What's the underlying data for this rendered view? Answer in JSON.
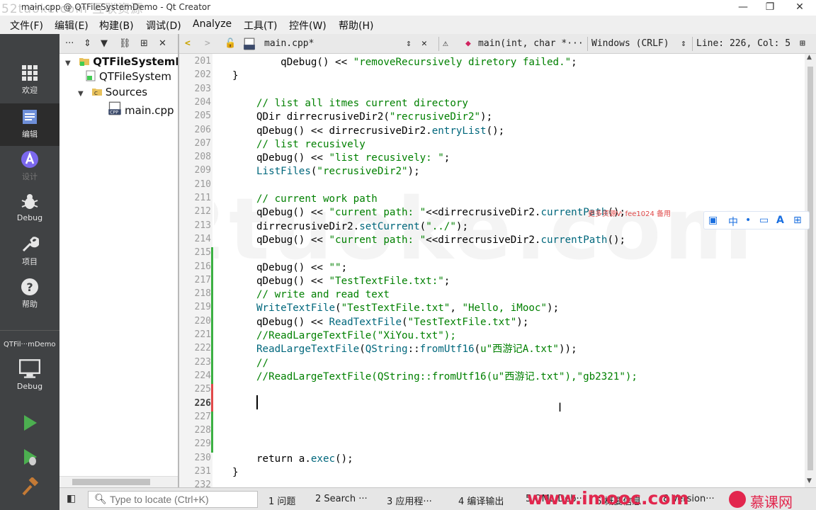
{
  "window": {
    "title": "main.cpp @ QTFileSystemDemo - Qt Creator",
    "watermark_top": "52tuoke.com  互联资源"
  },
  "menu": [
    "文件(F)",
    "编辑(E)",
    "构建(B)",
    "调试(D)",
    "Analyze",
    "工具(T)",
    "控件(W)",
    "帮助(H)"
  ],
  "modes": {
    "welcome": "欢迎",
    "edit": "编辑",
    "design": "设计",
    "debug": "Debug",
    "projects": "项目",
    "help": "帮助",
    "kit_name": "QTFil···mDemo",
    "kit_mode": "Debug"
  },
  "tree": {
    "project": "QTFileSystemDe",
    "pro_file": "QTFileSystem",
    "sources": "Sources",
    "file": "main.cpp"
  },
  "editor_toolbar": {
    "file": "main.cpp*",
    "function": "main(int, char *···",
    "line_ending": "Windows (CRLF)",
    "position": "Line: 226, Col: 5"
  },
  "editor": {
    "first_line": 201,
    "current_line": 226,
    "lines": [
      [
        [
          "    qDebug() << ",
          "t"
        ],
        [
          "\"removeRecursively diretory failed.\"",
          "s"
        ],
        [
          ";",
          "t"
        ]
      ],
      [
        [
          "}",
          "t"
        ]
      ],
      [
        [
          "",
          "t"
        ]
      ],
      [
        [
          "// list all itmes current directory",
          "c"
        ]
      ],
      [
        [
          "QDir dirrecrusiveDir2(",
          "t"
        ],
        [
          "\"recrusiveDir2\"",
          "s"
        ],
        [
          ");",
          "t"
        ]
      ],
      [
        [
          "qDebug() << dirrecrusiveDir2.",
          "t"
        ],
        [
          "entryList",
          "f"
        ],
        [
          "();",
          "t"
        ]
      ],
      [
        [
          "// list recusively",
          "c"
        ]
      ],
      [
        [
          "qDebug() << ",
          "t"
        ],
        [
          "\"list recusively: \"",
          "s"
        ],
        [
          ";",
          "t"
        ]
      ],
      [
        [
          "ListFiles",
          "f"
        ],
        [
          "(",
          "t"
        ],
        [
          "\"recrusiveDir2\"",
          "s"
        ],
        [
          ");",
          "t"
        ]
      ],
      [
        [
          "",
          "t"
        ]
      ],
      [
        [
          "// current work path",
          "c"
        ]
      ],
      [
        [
          "qDebug() << ",
          "t"
        ],
        [
          "\"current path: \"",
          "s"
        ],
        [
          "<<dirrecrusiveDir2.",
          "t"
        ],
        [
          "currentPath",
          "f"
        ],
        [
          "();",
          "t"
        ]
      ],
      [
        [
          "dirrecrusiveDir2.",
          "t"
        ],
        [
          "setCurrent",
          "f"
        ],
        [
          "(",
          "t"
        ],
        [
          "\"../\"",
          "s"
        ],
        [
          ");",
          "t"
        ]
      ],
      [
        [
          "qDebug() << ",
          "t"
        ],
        [
          "\"current path: \"",
          "s"
        ],
        [
          "<<dirrecrusiveDir2.",
          "t"
        ],
        [
          "currentPath",
          "f"
        ],
        [
          "();",
          "t"
        ]
      ],
      [
        [
          "",
          "t"
        ]
      ],
      [
        [
          "qDebug() << ",
          "t"
        ],
        [
          "\"\"",
          "s"
        ],
        [
          ";",
          "t"
        ]
      ],
      [
        [
          "qDebug() << ",
          "t"
        ],
        [
          "\"TestTextFile.txt:\"",
          "s"
        ],
        [
          ";",
          "t"
        ]
      ],
      [
        [
          "// write and read text",
          "c"
        ]
      ],
      [
        [
          "WriteTextFile",
          "f"
        ],
        [
          "(",
          "t"
        ],
        [
          "\"TestTextFile.txt\"",
          "s"
        ],
        [
          ", ",
          "t"
        ],
        [
          "\"Hello, iMooc\"",
          "s"
        ],
        [
          ");",
          "t"
        ]
      ],
      [
        [
          "qDebug() << ",
          "t"
        ],
        [
          "ReadTextFile",
          "f"
        ],
        [
          "(",
          "t"
        ],
        [
          "\"TestTextFile.txt\"",
          "s"
        ],
        [
          ");",
          "t"
        ]
      ],
      [
        [
          "//ReadLargeTextFile(\"XiYou.txt\");",
          "c"
        ]
      ],
      [
        [
          "ReadLargeTextFile",
          "f"
        ],
        [
          "(",
          "t"
        ],
        [
          "QString",
          "f"
        ],
        [
          "::",
          "t"
        ],
        [
          "fromUtf16",
          "f"
        ],
        [
          "(",
          "t"
        ],
        [
          "u\"西游记A.txt\"",
          "s"
        ],
        [
          "));",
          "t"
        ]
      ],
      [
        [
          "//",
          "c"
        ]
      ],
      [
        [
          "//ReadLargeTextFile(QString::fromUtf16(u\"西游记.txt\"),\"gb2321\");",
          "c"
        ]
      ],
      [
        [
          "",
          "t"
        ]
      ],
      [
        [
          "",
          "t"
        ]
      ],
      [
        [
          "",
          "t"
        ]
      ],
      [
        [
          "",
          "t"
        ]
      ],
      [
        [
          "",
          "t"
        ]
      ],
      [
        [
          "return a.",
          "t"
        ],
        [
          "exec",
          "f"
        ],
        [
          "();",
          "t"
        ]
      ],
      [
        [
          "}",
          "t"
        ]
      ],
      [
        [
          "",
          "t"
        ]
      ]
    ],
    "line_indent": [
      1,
      0,
      1,
      1,
      1,
      1,
      1,
      1,
      1,
      1,
      1,
      1,
      1,
      1,
      1,
      1,
      1,
      1,
      1,
      1,
      1,
      1,
      1,
      1,
      1,
      1,
      1,
      1,
      1,
      1,
      0,
      0
    ],
    "watermark_big": "52tuoke.com",
    "watermark_contact": "更多资源V: fee1024 备用"
  },
  "ime": [
    "中",
    "•",
    "📋",
    "A",
    "⊞"
  ],
  "statusbar": {
    "locate_placeholder": "Type to locate (Ctrl+K)",
    "tabs": [
      "1  问题",
      "2  Search ···",
      "3  应用程···",
      "4  编译输出",
      "5  QML Deb···",
      "6  概要信息",
      "8  Version···"
    ],
    "brand": "www.imooc.com",
    "brand_cn": "慕课网"
  },
  "colors": {
    "mode_bar": "#404244",
    "change_green": "#3cb043",
    "change_red": "#e04a4a",
    "brand": "#e2264d"
  }
}
